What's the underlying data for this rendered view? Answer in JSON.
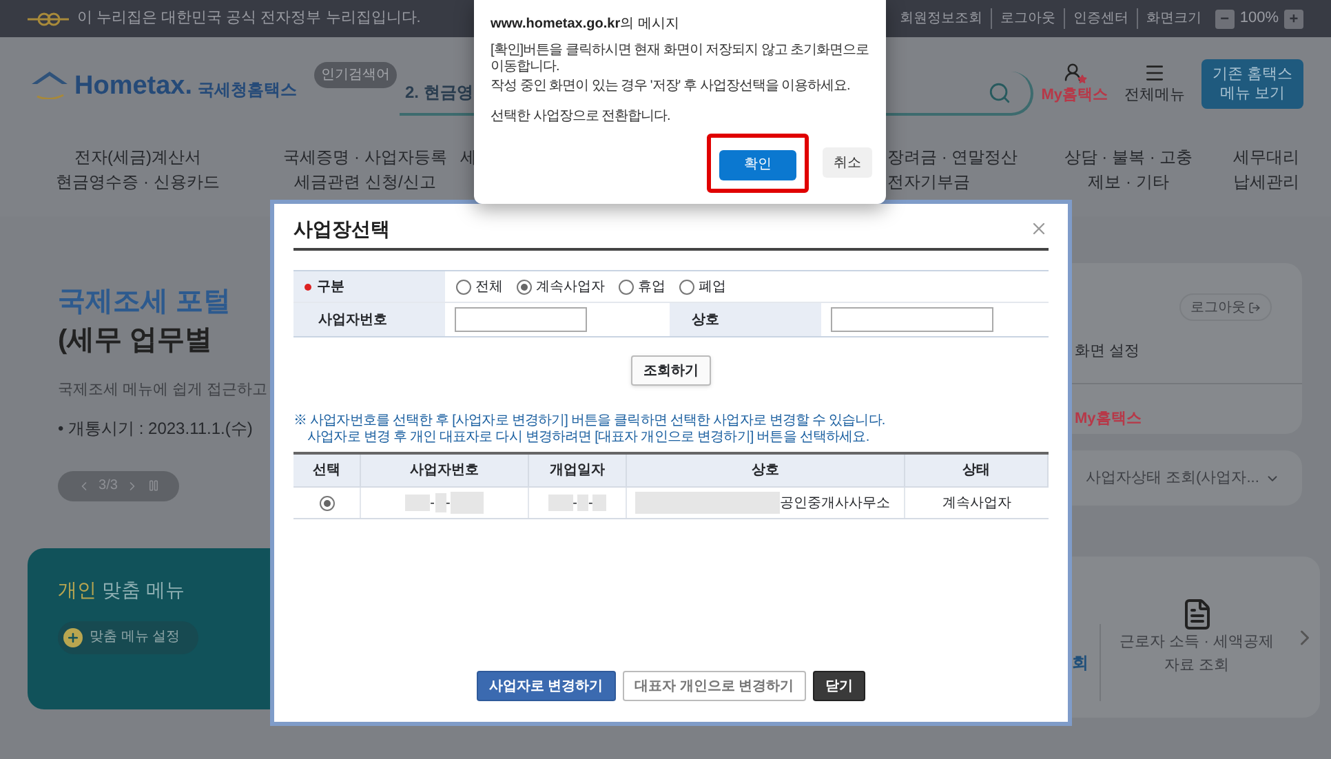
{
  "top_bar": {
    "notice": "이 누리집은 대한민국 공식 전자정부 누리집입니다.",
    "links": [
      "회원정보조회",
      "로그아웃",
      "인증센터",
      "화면크기"
    ],
    "zoom": {
      "minus": "−",
      "value": "100%",
      "plus": "+"
    }
  },
  "header": {
    "logo": "Hometax.",
    "logo_label": "국세청홈택스",
    "popular_badge": "인기검색어",
    "search_value": "2. 현금영",
    "my_hometax": "My홈택스",
    "all_menu": "전체메뉴",
    "legacy_button": "기존 홈택스 메뉴 보기"
  },
  "nav": [
    {
      "kind": "center",
      "lines": [
        "전자(세금)계산서",
        "현금영수증 · 신용카드"
      ]
    },
    {
      "kind": "center",
      "lines": [
        "국세증명 · 사업자등록",
        "세금관련 신청/신고"
      ]
    },
    {
      "kind": "partial",
      "lines": [
        "세"
      ]
    },
    {
      "kind": "partial",
      "lines": [
        "장려금 · 연말정산",
        "전자기부금"
      ]
    },
    {
      "kind": "center",
      "lines": [
        "상담 · 불복 · 고충",
        "제보 · 기타"
      ]
    },
    {
      "kind": "center",
      "lines": [
        "세무대리",
        "납세관리"
      ]
    }
  ],
  "hero": {
    "title_highlight": "국제조세 포털",
    "title_line2": "(세무 업무별",
    "description": "국제조세 메뉴에 쉽게 접근하고",
    "date": "• 개통시기 : 2023.11.1.(수)",
    "pager": "3/3"
  },
  "custom_menu": {
    "title_highlight": "개인",
    "title_rest": "맞춤 메뉴",
    "setting": "맞춤 메뉴 설정"
  },
  "side_panel": {
    "logout": "로그아웃",
    "screen_setting": "화면 설정",
    "my_hometax": "My홈택스",
    "status_select": "사업자상태 조회(사업자...",
    "partial_link": "회",
    "shortcut": [
      "근로자 소득 · 세액공제",
      "자료 조회"
    ]
  },
  "modal": {
    "title": "사업장선택",
    "form": {
      "type_label": "구분",
      "radios": [
        {
          "label": "전체",
          "selected": false
        },
        {
          "label": "계속사업자",
          "selected": true
        },
        {
          "label": "휴업",
          "selected": false
        },
        {
          "label": "폐업",
          "selected": false
        }
      ],
      "number_label": "사업자번호",
      "name_label": "상호"
    },
    "search_button": "조회하기",
    "notes": [
      "※ 사업자번호를 선택한 후 [사업자로 변경하기] 버튼을 클릭하면 선택한 사업자로 변경할 수 있습니다.",
      "사업자로 변경 후 개인 대표자로 다시 변경하려면 [대표자 개인으로 변경하기] 버튼을 선택하세요."
    ],
    "table": {
      "columns": [
        "선택",
        "사업자번호",
        "개업일자",
        "상호",
        "상태"
      ],
      "rows": [
        {
          "selected": true,
          "number_separators": [
            "-",
            "-"
          ],
          "date_separators": [
            "-",
            "-"
          ],
          "name_suffix": "공인중개사사무소",
          "status": "계속사업자"
        }
      ]
    },
    "buttons": [
      {
        "kind": "primary",
        "label": "사업자로 변경하기"
      },
      {
        "kind": "secondary",
        "label": "대표자 개인으로 변경하기"
      },
      {
        "kind": "dark",
        "label": "닫기"
      }
    ]
  },
  "alert": {
    "title": "**www.hometax.go.kr**의 메시지",
    "lines": [
      "[확인]버튼을 클릭하시면 현재 화면이 저장되지 않고 초기화면으로 이동합니다.",
      "작성 중인 화면이 있는 경우 '저장' 후 사업장선택을 이용하세요.",
      "선택한 사업장으로 전환합니다."
    ],
    "ok": "확인",
    "cancel": "취소",
    "ok_highlighted": true
  }
}
